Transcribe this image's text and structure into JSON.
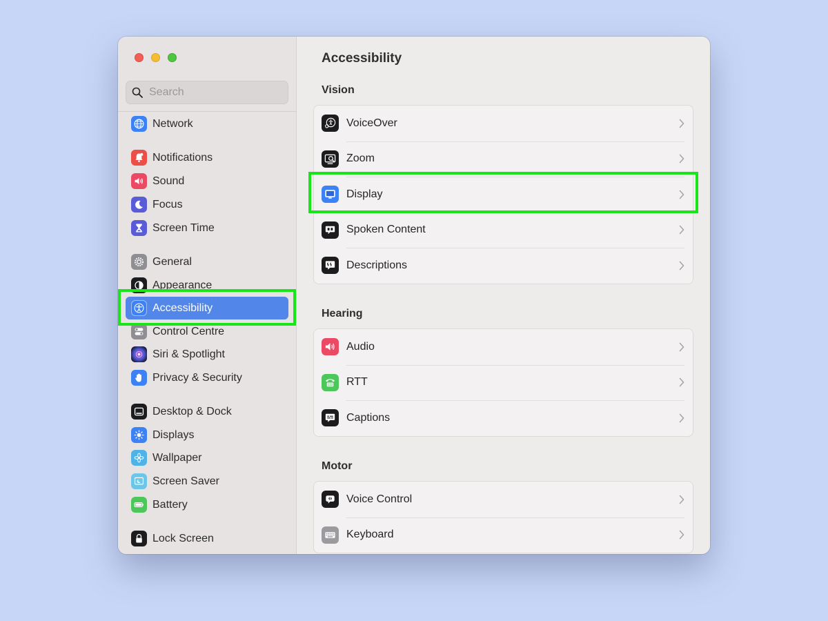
{
  "window": {
    "title": "Accessibility"
  },
  "search": {
    "placeholder": "Search"
  },
  "sidebar": {
    "items": [
      {
        "label": "Network",
        "icon": "globe-icon",
        "color": "#3d82f4"
      },
      {
        "label": "Notifications",
        "icon": "bell-icon",
        "color": "#ec4f48"
      },
      {
        "label": "Sound",
        "icon": "speaker-icon",
        "color": "#ec4a64"
      },
      {
        "label": "Focus",
        "icon": "moon-icon",
        "color": "#5a5bd6"
      },
      {
        "label": "Screen Time",
        "icon": "hourglass-icon",
        "color": "#5a5bd6"
      },
      {
        "label": "General",
        "icon": "gear-icon",
        "color": "#8e8e93"
      },
      {
        "label": "Appearance",
        "icon": "appearance-icon",
        "color": "#1c1c1e"
      },
      {
        "label": "Accessibility",
        "icon": "accessibility-icon",
        "color": "#3d82f4"
      },
      {
        "label": "Control Centre",
        "icon": "toggles-icon",
        "color": "#8e8e93"
      },
      {
        "label": "Siri & Spotlight",
        "icon": "siri-icon",
        "color": "#3b2f70"
      },
      {
        "label": "Privacy & Security",
        "icon": "hand-icon",
        "color": "#3d82f4"
      },
      {
        "label": "Desktop & Dock",
        "icon": "dock-icon",
        "color": "#1c1c1e"
      },
      {
        "label": "Displays",
        "icon": "sun-icon",
        "color": "#3d82f4"
      },
      {
        "label": "Wallpaper",
        "icon": "flower-icon",
        "color": "#4fb3e8"
      },
      {
        "label": "Screen Saver",
        "icon": "screensaver-icon",
        "color": "#6cc6e8"
      },
      {
        "label": "Battery",
        "icon": "battery-icon",
        "color": "#4cc75a"
      },
      {
        "label": "Lock Screen",
        "icon": "lock-icon",
        "color": "#1c1c1e"
      }
    ]
  },
  "sections": {
    "vision": {
      "title": "Vision",
      "rows": [
        {
          "label": "VoiceOver",
          "icon": "voiceover-icon"
        },
        {
          "label": "Zoom",
          "icon": "zoom-icon"
        },
        {
          "label": "Display",
          "icon": "display-icon"
        },
        {
          "label": "Spoken Content",
          "icon": "spoken-content-icon"
        },
        {
          "label": "Descriptions",
          "icon": "descriptions-icon"
        }
      ]
    },
    "hearing": {
      "title": "Hearing",
      "rows": [
        {
          "label": "Audio",
          "icon": "audio-icon"
        },
        {
          "label": "RTT",
          "icon": "rtt-icon"
        },
        {
          "label": "Captions",
          "icon": "captions-icon"
        }
      ]
    },
    "motor": {
      "title": "Motor",
      "rows": [
        {
          "label": "Voice Control",
          "icon": "voice-control-icon"
        },
        {
          "label": "Keyboard",
          "icon": "keyboard-icon"
        }
      ]
    }
  },
  "colors": {
    "accent": "#5286e8",
    "highlight": "#19e619",
    "background": "#c7d6f7"
  }
}
